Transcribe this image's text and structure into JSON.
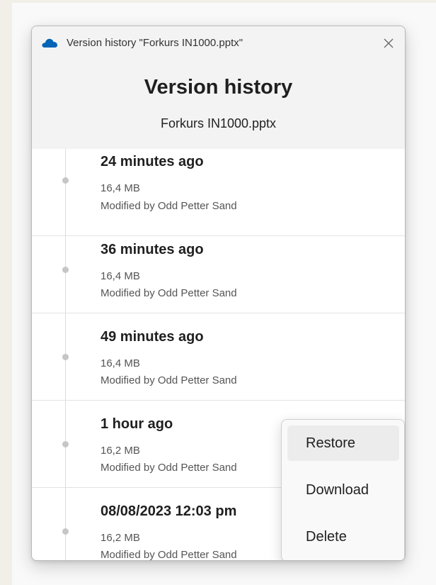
{
  "window": {
    "title": "Version history \"Forkurs IN1000.pptx\""
  },
  "header": {
    "title": "Version history",
    "filename": "Forkurs IN1000.pptx"
  },
  "versions": [
    {
      "time": "24 minutes ago",
      "size": "16,4 MB",
      "modified": "Modified by Odd Petter Sand"
    },
    {
      "time": "36 minutes ago",
      "size": "16,4 MB",
      "modified": "Modified by Odd Petter Sand"
    },
    {
      "time": "49 minutes ago",
      "size": "16,4 MB",
      "modified": "Modified by Odd Petter Sand"
    },
    {
      "time": "1 hour ago",
      "size": "16,2 MB",
      "modified": "Modified by Odd Petter Sand"
    },
    {
      "time": "08/08/2023 12:03 pm",
      "size": "16,2 MB",
      "modified": "Modified by Odd Petter Sand"
    }
  ],
  "context_menu": {
    "restore": "Restore",
    "download": "Download",
    "delete": "Delete"
  },
  "icons": {
    "app": "onedrive-cloud-icon",
    "close": "close-icon"
  },
  "colors": {
    "onedrive_blue": "#0364b8",
    "header_bg": "#f3f3f3"
  }
}
